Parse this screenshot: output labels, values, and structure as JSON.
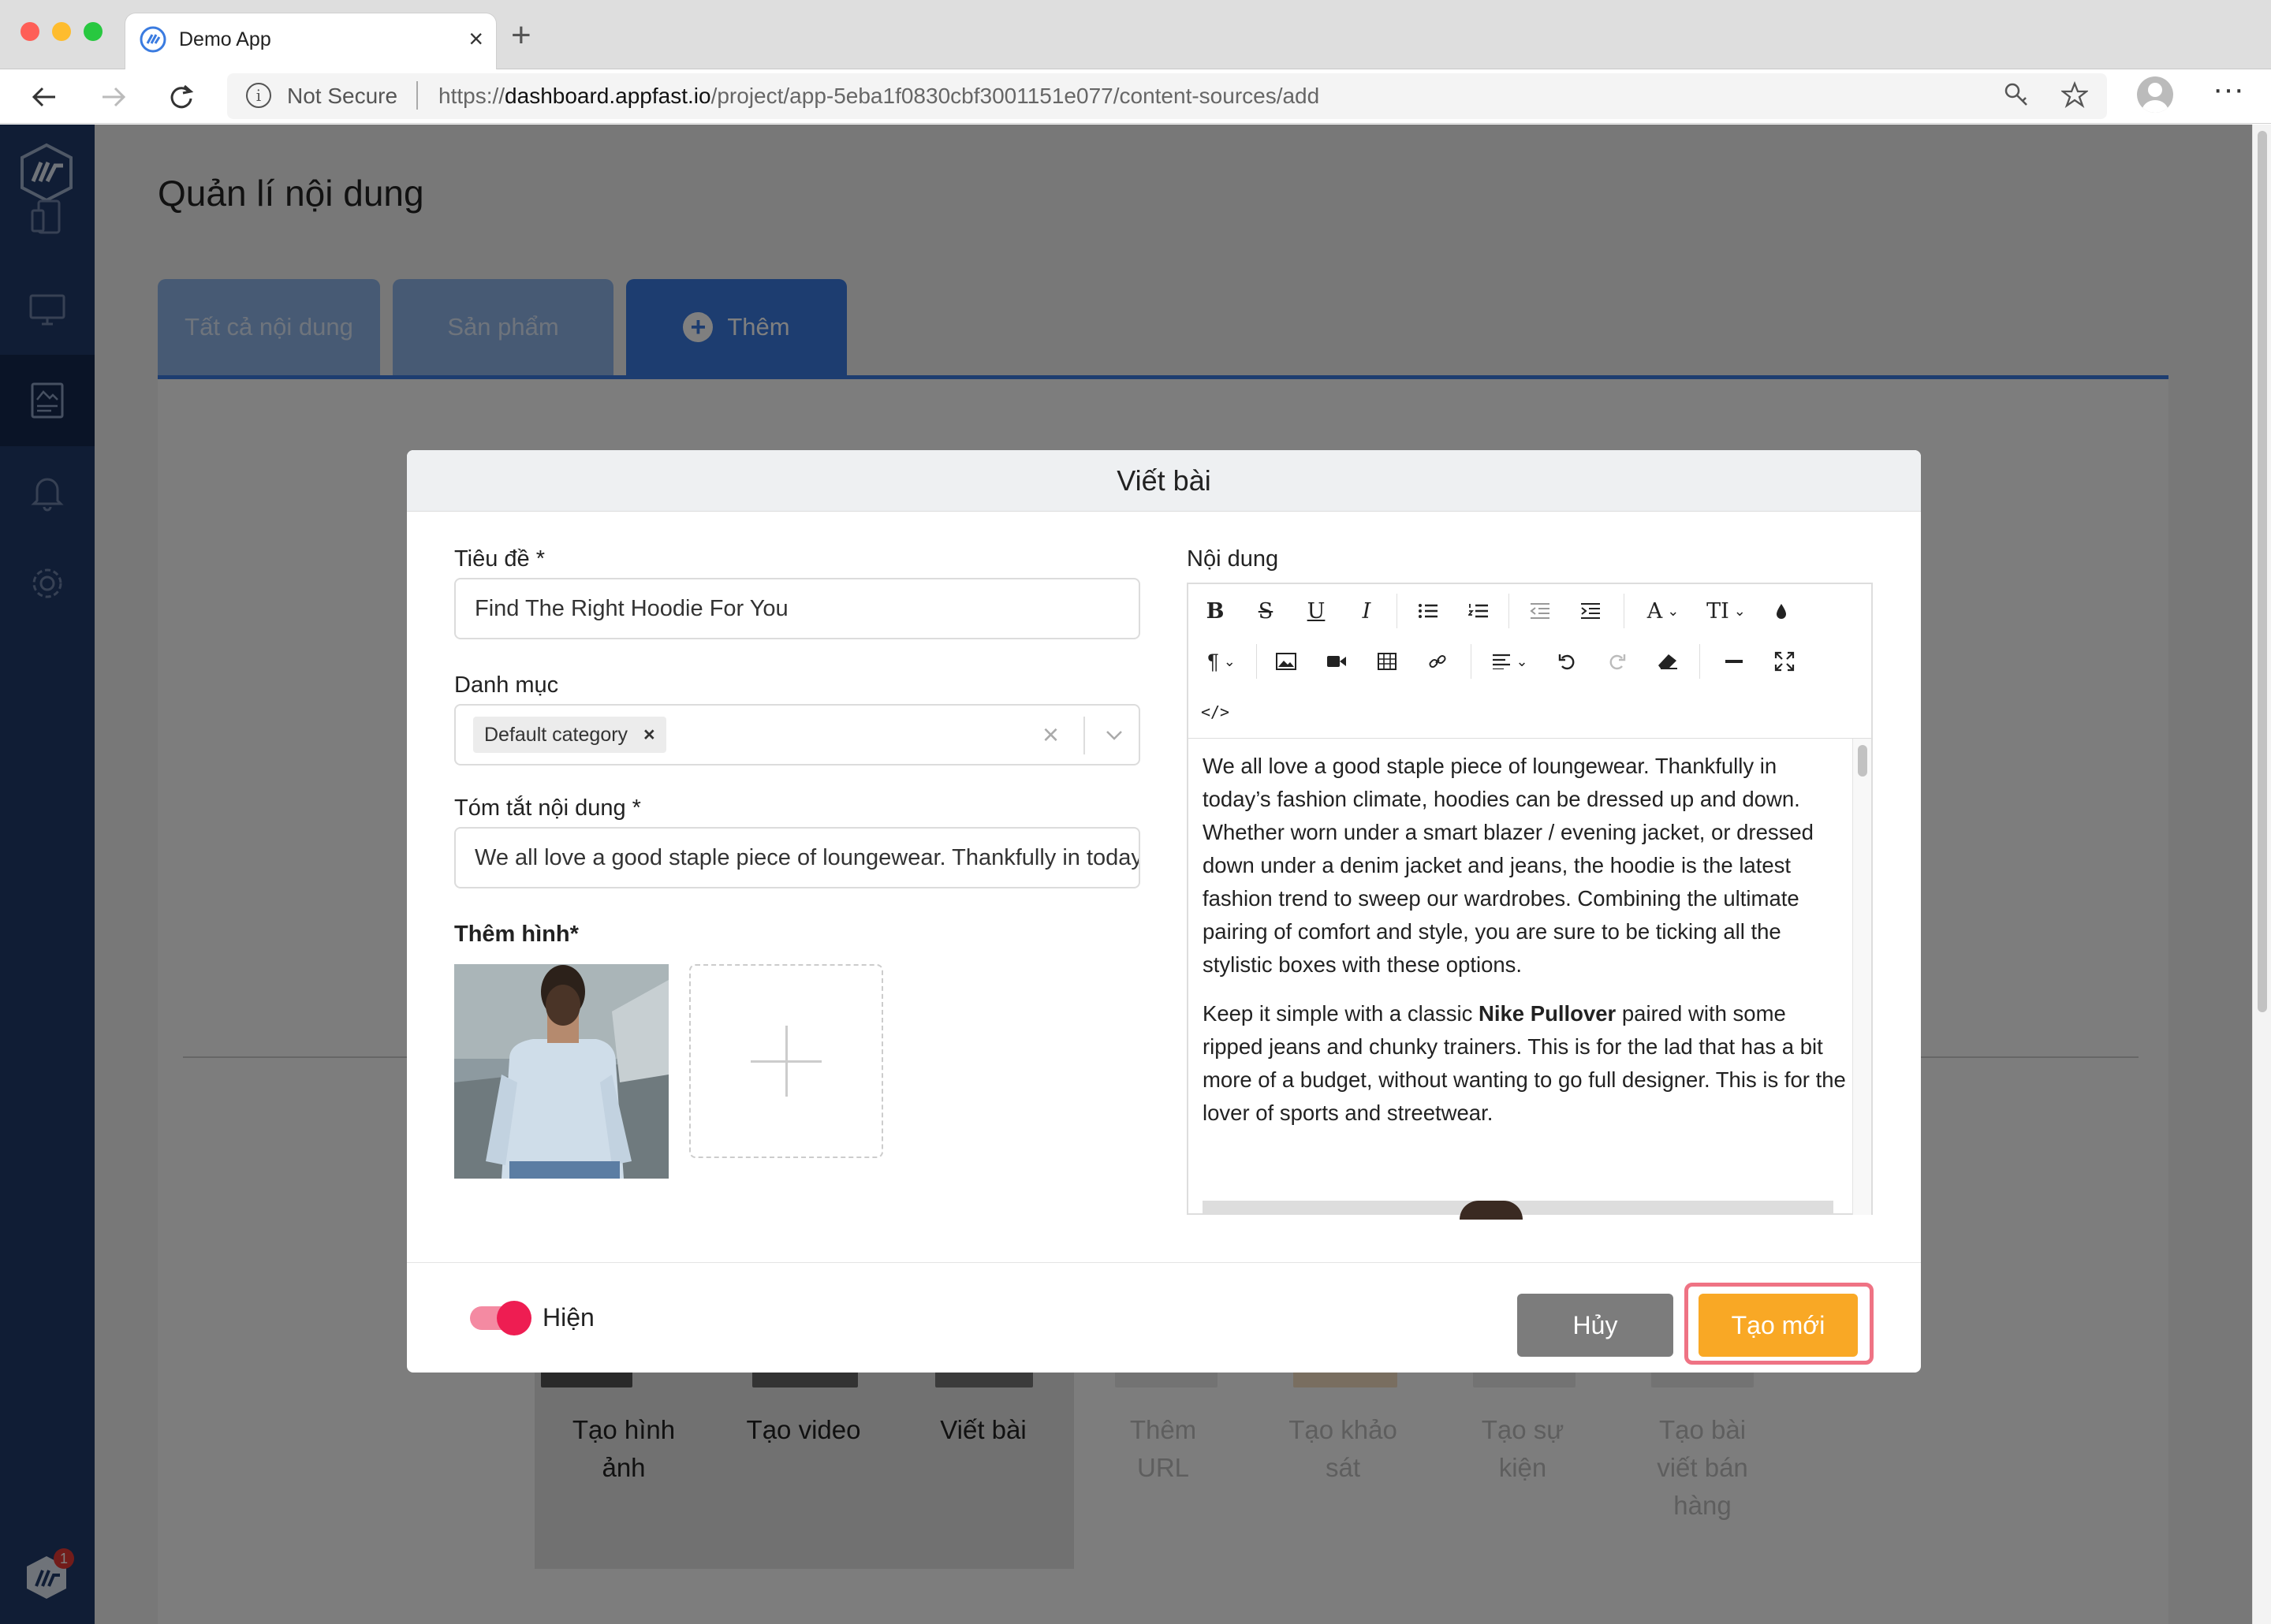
{
  "browser": {
    "tab_title": "Demo App",
    "not_secure": "Not Secure",
    "url_scheme": "https://",
    "url_domain": "dashboard.appfast.io",
    "url_path": "/project/app-5eba1f0830cbf3001151e077/content-sources/add"
  },
  "sidebar": {
    "items": [
      "devices-icon",
      "monitor-icon",
      "content-icon",
      "bell-icon",
      "settings-icon"
    ],
    "active": "content-icon",
    "notification_count": "1"
  },
  "page": {
    "title": "Quản lí nội dung",
    "tabs": [
      {
        "label": "Tất cả nội dung",
        "active": false
      },
      {
        "label": "Sản phẩm",
        "active": false
      },
      {
        "label": "Thêm",
        "active": true
      }
    ]
  },
  "background_choices": [
    {
      "label": "Tạo hình ảnh",
      "enabled": true
    },
    {
      "label": "Tạo video",
      "enabled": true
    },
    {
      "label": "Viết bài",
      "enabled": true
    },
    {
      "label": "Thêm URL",
      "enabled": false
    },
    {
      "label": "Tạo khảo sát",
      "enabled": false
    },
    {
      "label": "Tạo sự kiện",
      "enabled": false
    },
    {
      "label": "Tạo bài viết bán hàng",
      "enabled": false
    }
  ],
  "modal": {
    "title": "Viết bài",
    "title_label": "Tiêu đề *",
    "title_value": "Find The Right Hoodie For You",
    "category_label": "Danh mục",
    "category_tag": "Default category",
    "summary_label": "Tóm tắt nội dung *",
    "summary_value": "We all love a good staple piece of loungewear. Thankfully in today’",
    "image_label": "Thêm hình*",
    "content_label": "Nội dung",
    "content_p1": "We all love a good staple piece of loungewear. Thankfully in today’s fashion climate, hoodies can be dressed up and down. Whether worn under a smart blazer / evening jacket, or dressed down under a denim jacket and jeans, the hoodie is the latest fashion trend to sweep our wardrobes. Combining the ultimate pairing of comfort and style, you are sure to be ticking all the stylistic boxes with these options.",
    "content_p2_before": "Keep it simple with a classic ",
    "content_p2_bold": "Nike Pullover",
    "content_p2_after": " paired with some ripped jeans and chunky trainers. This is for the lad that has a bit more of a budget, without wanting to go full designer. This is for the lover of sports and streetwear.",
    "visible_toggle": true,
    "visible_label": "Hiện",
    "cancel_label": "Hủy",
    "create_label": "Tạo mới"
  },
  "colors": {
    "sidebar": "#203a6b",
    "tab_active": "#3a7be0",
    "toggle": "#ee1d52",
    "create_button": "#f9a825",
    "cancel_button": "#7c7c7c",
    "highlight": "#ef7384"
  }
}
